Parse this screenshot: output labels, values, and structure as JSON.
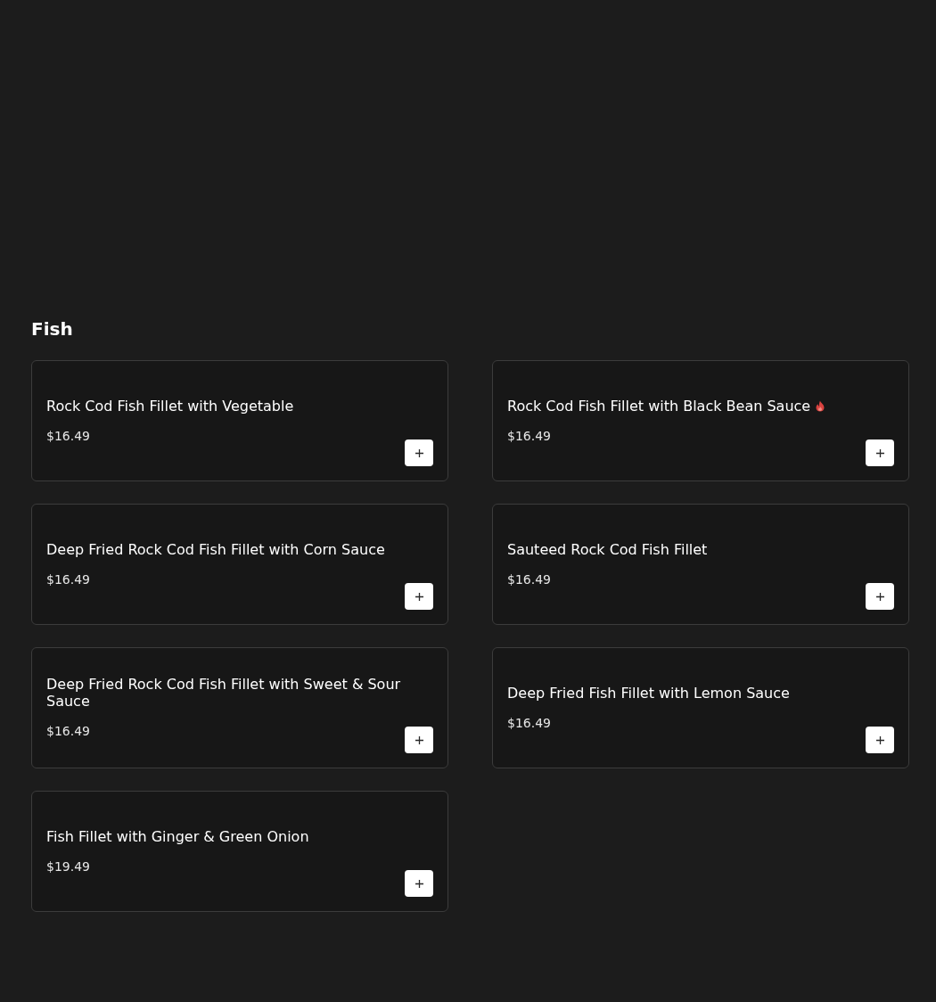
{
  "section": {
    "title": "Fish"
  },
  "items": [
    {
      "name": "Rock Cod Fish Fillet with Vegetable",
      "price": "$16.49",
      "spicy": false
    },
    {
      "name": "Rock Cod Fish Fillet with Black Bean Sauce",
      "price": "$16.49",
      "spicy": true
    },
    {
      "name": "Deep Fried Rock Cod Fish Fillet with Corn Sauce",
      "price": "$16.49",
      "spicy": false
    },
    {
      "name": "Sauteed Rock Cod Fish Fillet",
      "price": "$16.49",
      "spicy": false
    },
    {
      "name": "Deep Fried Rock Cod Fish Fillet with Sweet & Sour Sauce",
      "price": "$16.49",
      "spicy": false
    },
    {
      "name": "Deep Fried Fish Fillet with Lemon Sauce",
      "price": "$16.49",
      "spicy": false
    },
    {
      "name": "Fish Fillet with Ginger & Green Onion",
      "price": "$19.49",
      "spicy": false
    }
  ]
}
